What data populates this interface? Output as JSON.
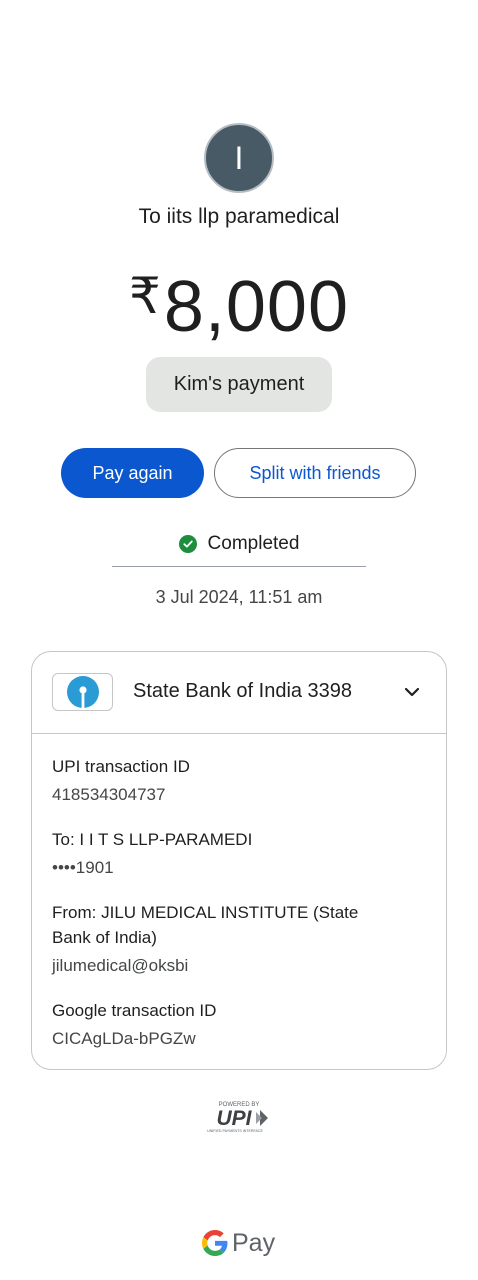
{
  "avatar": {
    "initial": "I",
    "color": "#475a66"
  },
  "payment": {
    "recipient": "To iits llp paramedical",
    "currency_symbol": "₹",
    "amount": "8,000",
    "note": "Kim's payment"
  },
  "actions": {
    "pay_again": "Pay again",
    "split": "Split with friends"
  },
  "status": {
    "text": "Completed",
    "icon": "check-circle-icon",
    "color": "#1e8e3e"
  },
  "datetime": "3 Jul 2024, 11:51 am",
  "bank": {
    "name": "State Bank of India 3398",
    "logo_icon": "sbi-logo-icon",
    "logo_color": "#2a9bd5"
  },
  "details": {
    "upi_label": "UPI transaction ID",
    "upi_value": "418534304737",
    "to_label": "To: I I T S LLP-PARAMEDI",
    "to_value": "••••1901",
    "from_label_line1": "From: JILU MEDICAL INSTITUTE   (State",
    "from_label_line2": "Bank of India)",
    "from_value": "jilumedical@oksbi",
    "google_label": "Google transaction ID",
    "google_value": "CICAgLDa-bPGZw"
  },
  "footer": {
    "upi_powered": "POWERED BY",
    "upi_brand": "UPI",
    "upi_tagline": "UNIFIED PAYMENTS INTERFACE",
    "gpay_label": "Pay"
  },
  "accent_color": "#0b57d0"
}
